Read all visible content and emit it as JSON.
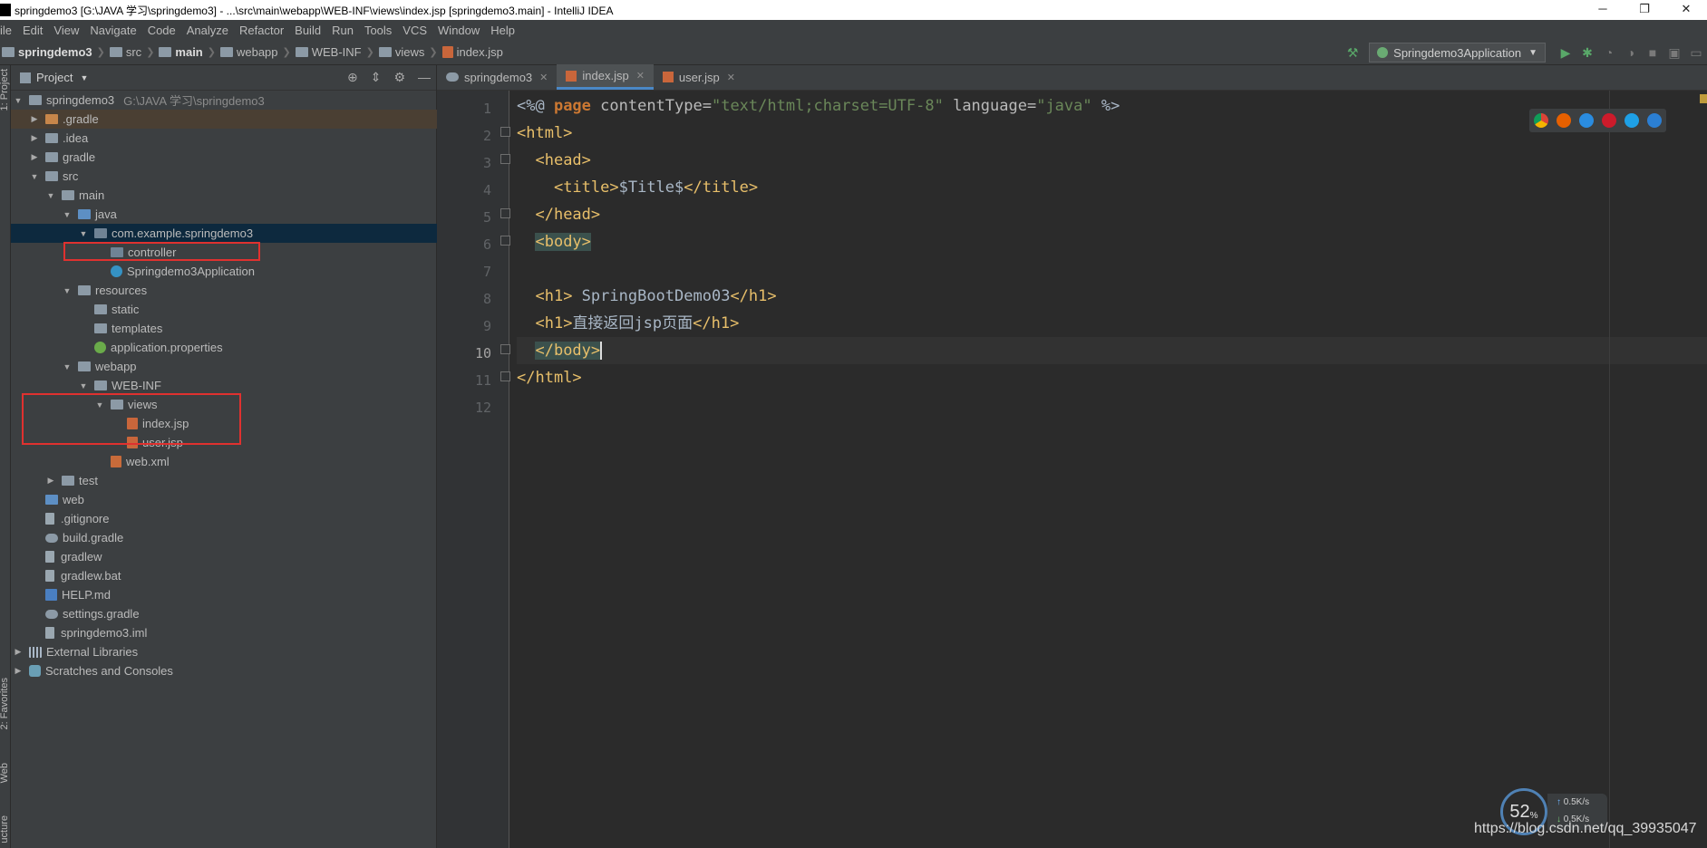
{
  "window": {
    "title": "springdemo3 [G:\\JAVA 学习\\springdemo3] - ...\\src\\main\\webapp\\WEB-INF\\views\\index.jsp [springdemo3.main] - IntelliJ IDEA",
    "minimize": "─",
    "restore": "❐",
    "close": "✕"
  },
  "menu": [
    "ile",
    "Edit",
    "View",
    "Navigate",
    "Code",
    "Analyze",
    "Refactor",
    "Build",
    "Run",
    "Tools",
    "VCS",
    "Window",
    "Help"
  ],
  "breadcrumb": [
    "springdemo3",
    "src",
    "main",
    "webapp",
    "WEB-INF",
    "views",
    "index.jsp"
  ],
  "run_config": "Springdemo3Application",
  "left_strip": {
    "project": "1: Project",
    "favorites": "2: Favorites",
    "web": "Web",
    "structure": "ucture"
  },
  "project_panel": {
    "title": "Project",
    "tree": [
      {
        "label": "springdemo3",
        "path": "G:\\JAVA 学习\\springdemo3"
      },
      {
        "label": ".gradle"
      },
      {
        "label": ".idea"
      },
      {
        "label": "gradle"
      },
      {
        "label": "src"
      },
      {
        "label": "main"
      },
      {
        "label": "java"
      },
      {
        "label": "com.example.springdemo3"
      },
      {
        "label": "controller"
      },
      {
        "label": "Springdemo3Application"
      },
      {
        "label": "resources"
      },
      {
        "label": "static"
      },
      {
        "label": "templates"
      },
      {
        "label": "application.properties"
      },
      {
        "label": "webapp"
      },
      {
        "label": "WEB-INF"
      },
      {
        "label": "views"
      },
      {
        "label": "index.jsp"
      },
      {
        "label": "user.jsp"
      },
      {
        "label": "web.xml"
      },
      {
        "label": "test"
      },
      {
        "label": "web"
      },
      {
        "label": ".gitignore"
      },
      {
        "label": "build.gradle"
      },
      {
        "label": "gradlew"
      },
      {
        "label": "gradlew.bat"
      },
      {
        "label": "HELP.md"
      },
      {
        "label": "settings.gradle"
      },
      {
        "label": "springdemo3.iml"
      },
      {
        "label": "External Libraries"
      },
      {
        "label": "Scratches and Consoles"
      }
    ]
  },
  "editor": {
    "tabs": [
      "springdemo3",
      "index.jsp",
      "user.jsp"
    ],
    "active_tab": "index.jsp",
    "line_numbers": [
      "1",
      "2",
      "3",
      "4",
      "5",
      "6",
      "7",
      "8",
      "9",
      "10",
      "11",
      "12"
    ],
    "current_line": 10,
    "code": {
      "l1_open": "<%@ ",
      "l1_page": "page",
      "l1_ct": " contentType=",
      "l1_ctv": "\"text/html;charset=UTF-8\"",
      "l1_lang": " language=",
      "l1_langv": "\"java\"",
      "l1_close": " %>",
      "l2": "<html>",
      "l3": "<head>",
      "l4_open": "<title>",
      "l4_text": "$Title$",
      "l4_close": "</title>",
      "l5": "</head>",
      "l6": "<body>",
      "l8_open": "<h1>",
      "l8_text": " SpringBootDemo03",
      "l8_close": "</h1>",
      "l9_open": "<h1>",
      "l9_text": "直接返回jsp页面",
      "l9_close": "</h1>",
      "l10": "</body>",
      "l11": "</html>"
    }
  },
  "colors": {
    "accent": "#4a88c7",
    "highlight_box": "#e0312f",
    "selection": "#0d293e"
  },
  "net_widget": {
    "cpu": "52",
    "unit": "%",
    "up": "0.5K/s",
    "down": "0.5K/s"
  },
  "watermark": "https://blog.csdn.net/qq_39935047"
}
